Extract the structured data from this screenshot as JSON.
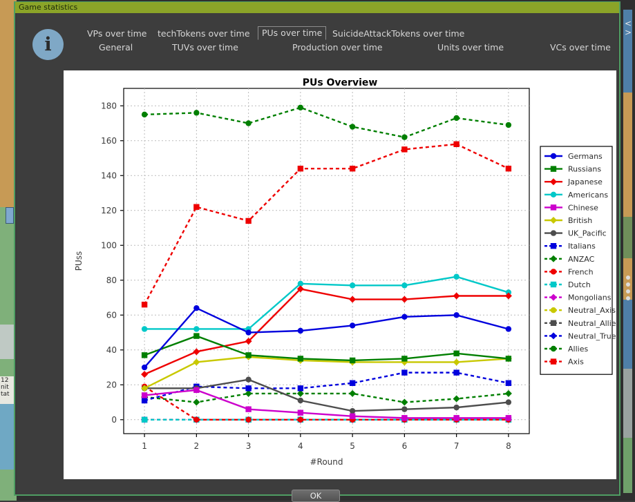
{
  "window": {
    "title": "Game statistics",
    "info_icon": "info-icon",
    "info_glyph": "i"
  },
  "tabs": {
    "row1": [
      {
        "label": "VPs over time",
        "selected": false
      },
      {
        "label": "techTokens over time",
        "selected": false
      },
      {
        "label": "PUs over time",
        "selected": true
      },
      {
        "label": "SuicideAttackTokens over time",
        "selected": false
      }
    ],
    "row2": [
      {
        "label": "General",
        "selected": false
      },
      {
        "label": "TUVs over time",
        "selected": false
      },
      {
        "label": "Production over time",
        "selected": false
      },
      {
        "label": "Units over time",
        "selected": false
      },
      {
        "label": "VCs over time",
        "selected": false
      }
    ]
  },
  "buttons": {
    "ok_label": "OK"
  },
  "colors": {
    "title_bar": "#8ba428",
    "window_frame": "#4f9e63",
    "dialog_bg": "#3d3d3d",
    "panel_bg": "#ffffff",
    "info_icon": "#7fa8c6"
  },
  "chart_data": {
    "type": "line",
    "title": "PUs Overview",
    "xlabel": "#Round",
    "ylabel": "PUss",
    "x": [
      1,
      2,
      3,
      4,
      5,
      6,
      7,
      8
    ],
    "xlim": [
      0.6,
      8.4
    ],
    "ylim": [
      -8,
      190
    ],
    "yticks": [
      0,
      20,
      40,
      60,
      80,
      100,
      120,
      140,
      160,
      180
    ],
    "grid": true,
    "legend_position": "right",
    "series": [
      {
        "name": "Germans",
        "color": "#0000dd",
        "marker": "circle",
        "dashed": false,
        "values": [
          30,
          64,
          50,
          51,
          54,
          59,
          60,
          52
        ]
      },
      {
        "name": "Russians",
        "color": "#007f00",
        "marker": "square",
        "dashed": false,
        "values": [
          37,
          48,
          37,
          35,
          34,
          35,
          38,
          35
        ]
      },
      {
        "name": "Japanese",
        "color": "#ee0000",
        "marker": "diamond",
        "dashed": false,
        "values": [
          26,
          39,
          45,
          75,
          69,
          69,
          71,
          71
        ]
      },
      {
        "name": "Americans",
        "color": "#00c8c8",
        "marker": "circle",
        "dashed": false,
        "values": [
          52,
          52,
          52,
          78,
          77,
          77,
          82,
          73
        ]
      },
      {
        "name": "Chinese",
        "color": "#cc00cc",
        "marker": "square",
        "dashed": false,
        "values": [
          14,
          17,
          6,
          4,
          2,
          1,
          1,
          1
        ]
      },
      {
        "name": "British",
        "color": "#c8c800",
        "marker": "diamond",
        "dashed": false,
        "values": [
          18,
          33,
          36,
          34,
          33,
          33,
          33,
          35
        ]
      },
      {
        "name": "UK_Pacific",
        "color": "#4d4d4d",
        "marker": "circle",
        "dashed": false,
        "values": [
          18,
          18,
          23,
          11,
          5,
          6,
          7,
          10
        ]
      },
      {
        "name": "Italians",
        "color": "#0000dd",
        "marker": "square",
        "dashed": true,
        "values": [
          11,
          19,
          18,
          18,
          21,
          27,
          27,
          21
        ]
      },
      {
        "name": "ANZAC",
        "color": "#007f00",
        "marker": "diamond",
        "dashed": true,
        "values": [
          13,
          10,
          15,
          15,
          15,
          10,
          12,
          15
        ]
      },
      {
        "name": "French",
        "color": "#ee0000",
        "marker": "circle",
        "dashed": true,
        "values": [
          19,
          0,
          0,
          0,
          0,
          0,
          0,
          0
        ]
      },
      {
        "name": "Dutch",
        "color": "#00c8c8",
        "marker": "square",
        "dashed": true,
        "values": [
          0,
          0,
          0,
          0,
          0,
          0,
          0,
          0
        ]
      },
      {
        "name": "Mongolians",
        "color": "#cc00cc",
        "marker": "diamond",
        "dashed": true,
        "values": [
          0,
          0,
          0,
          0,
          0,
          0,
          0,
          0
        ]
      },
      {
        "name": "Neutral_Axis",
        "color": "#c8c800",
        "marker": "circle",
        "dashed": true,
        "values": [
          0,
          0,
          0,
          0,
          0,
          0,
          0,
          0
        ]
      },
      {
        "name": "Neutral_Allies",
        "color": "#4d4d4d",
        "marker": "square",
        "dashed": true,
        "values": [
          0,
          0,
          0,
          0,
          0,
          0,
          0,
          0
        ]
      },
      {
        "name": "Neutral_True",
        "color": "#0000dd",
        "marker": "diamond",
        "dashed": true,
        "values": [
          0,
          0,
          0,
          0,
          0,
          0,
          0,
          0
        ]
      },
      {
        "name": "Allies",
        "color": "#007f00",
        "marker": "circle",
        "dashed": true,
        "values": [
          175,
          176,
          170,
          179,
          168,
          162,
          173,
          169
        ]
      },
      {
        "name": "Axis",
        "color": "#ee0000",
        "marker": "square",
        "dashed": true,
        "values": [
          66,
          122,
          114,
          144,
          144,
          155,
          158,
          144
        ]
      }
    ]
  },
  "map": {
    "badge_text": "12 nit tat"
  }
}
